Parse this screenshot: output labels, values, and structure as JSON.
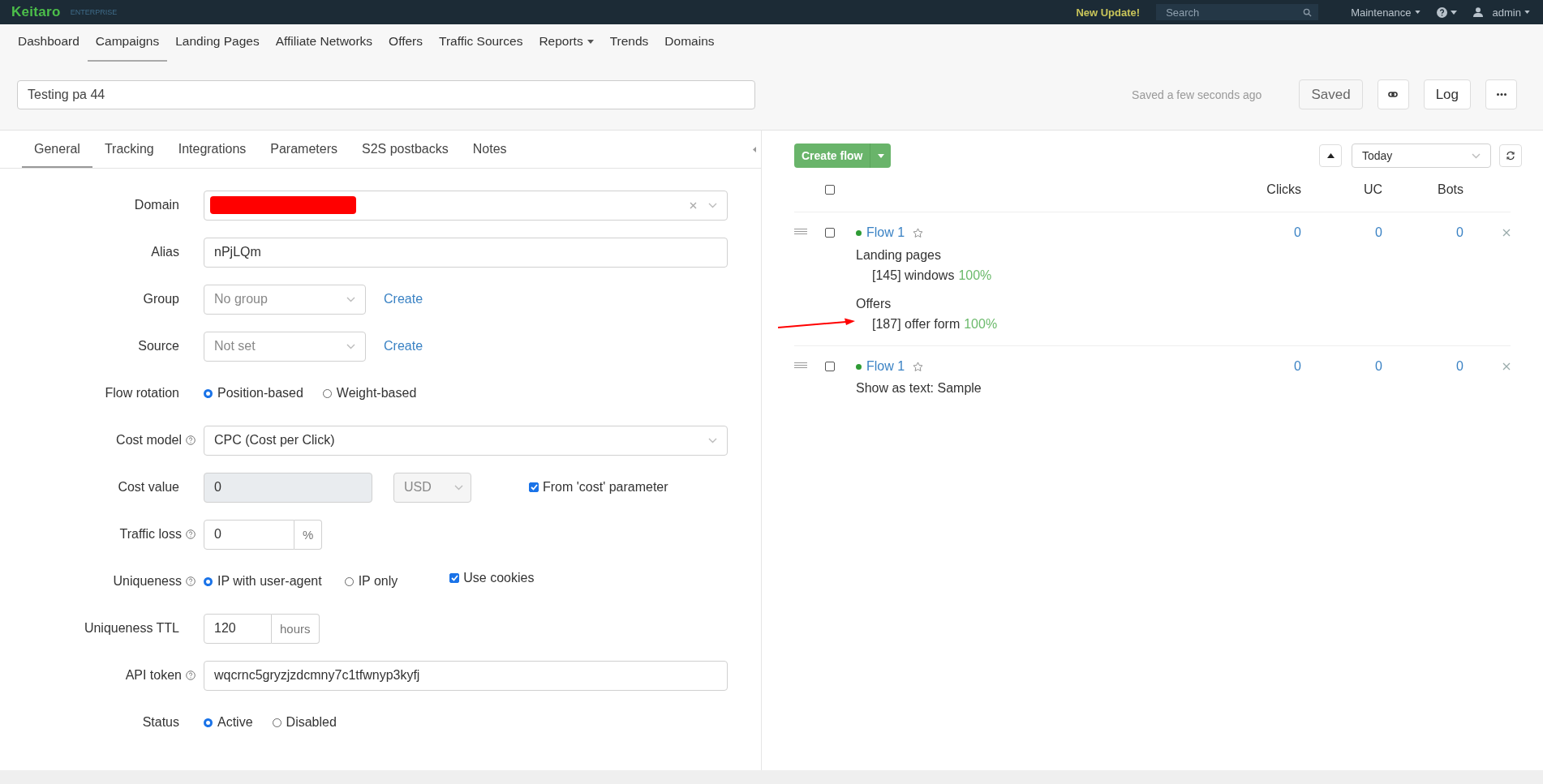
{
  "top_bar": {
    "logo": "Keitaro",
    "edition": "ENTERPRISE",
    "update_notice": "New Update!",
    "search": {
      "placeholder": "Search"
    },
    "maintenance": "Maintenance",
    "user": "admin"
  },
  "nav": [
    {
      "label": "Dashboard",
      "selected": false,
      "dropdown": false
    },
    {
      "label": "Campaigns",
      "selected": true,
      "dropdown": false
    },
    {
      "label": "Landing Pages",
      "selected": false,
      "dropdown": false
    },
    {
      "label": "Affiliate Networks",
      "selected": false,
      "dropdown": false
    },
    {
      "label": "Offers",
      "selected": false,
      "dropdown": false
    },
    {
      "label": "Traffic Sources",
      "selected": false,
      "dropdown": false
    },
    {
      "label": "Reports",
      "selected": false,
      "dropdown": true
    },
    {
      "label": "Trends",
      "selected": false,
      "dropdown": false
    },
    {
      "label": "Domains",
      "selected": false,
      "dropdown": false
    }
  ],
  "campaign": {
    "name": "Testing pa 44",
    "saved_status": "Saved a few seconds ago",
    "saved_button": "Saved",
    "log_button": "Log"
  },
  "form_tabs": [
    {
      "label": "General",
      "selected": true
    },
    {
      "label": "Tracking",
      "selected": false
    },
    {
      "label": "Integrations",
      "selected": false
    },
    {
      "label": "Parameters",
      "selected": false
    },
    {
      "label": "S2S postbacks",
      "selected": false
    },
    {
      "label": "Notes",
      "selected": false
    }
  ],
  "form": {
    "domain": {
      "label": "Domain"
    },
    "alias": {
      "label": "Alias",
      "value": "nPjLQm"
    },
    "group": {
      "label": "Group",
      "value": "No group",
      "link": "Create"
    },
    "source": {
      "label": "Source",
      "value": "Not set",
      "link": "Create"
    },
    "flow_rotation": {
      "label": "Flow rotation",
      "options": [
        {
          "label": "Position-based",
          "selected": true
        },
        {
          "label": "Weight-based",
          "selected": false
        }
      ]
    },
    "cost_model": {
      "label": "Cost model",
      "value": "CPC (Cost per Click)"
    },
    "cost_value": {
      "label": "Cost value",
      "value": "0",
      "currency": "USD",
      "checkbox": {
        "label": "From 'cost' parameter",
        "checked": true
      }
    },
    "traffic_loss": {
      "label": "Traffic loss",
      "value": "0",
      "unit": "%"
    },
    "uniqueness": {
      "label": "Uniqueness",
      "options": [
        {
          "label": "IP with user-agent",
          "selected": true
        },
        {
          "label": "IP only",
          "selected": false
        }
      ],
      "checkbox": {
        "label": "Use cookies",
        "checked": true
      }
    },
    "uniqueness_ttl": {
      "label": "Uniqueness TTL",
      "value": "120",
      "unit": "hours"
    },
    "api_token": {
      "label": "API token",
      "value": "wqcrnc5gryzjzdcmny7c1tfwnyp3kyfj"
    },
    "status": {
      "label": "Status",
      "options": [
        {
          "label": "Active",
          "selected": true
        },
        {
          "label": "Disabled",
          "selected": false
        }
      ]
    }
  },
  "flows_panel": {
    "create_button": "Create flow",
    "period": "Today",
    "columns": [
      "Clicks",
      "UC",
      "Bots"
    ],
    "select_all_checked": false,
    "flows": [
      {
        "name": "Flow 1",
        "checked": false,
        "sections": [
          {
            "title": "Landing pages",
            "items": [
              {
                "text": "[145] windows",
                "share": "100%",
                "annotated": false
              }
            ]
          },
          {
            "title": "Offers",
            "items": [
              {
                "text": "[187] offer form",
                "share": "100%",
                "annotated": true
              }
            ]
          }
        ],
        "clicks": "0",
        "uc": "0",
        "bots": "0"
      },
      {
        "name": "Flow 1",
        "checked": false,
        "description": "Show as text: Sample",
        "clicks": "0",
        "uc": "0",
        "bots": "0"
      }
    ]
  }
}
